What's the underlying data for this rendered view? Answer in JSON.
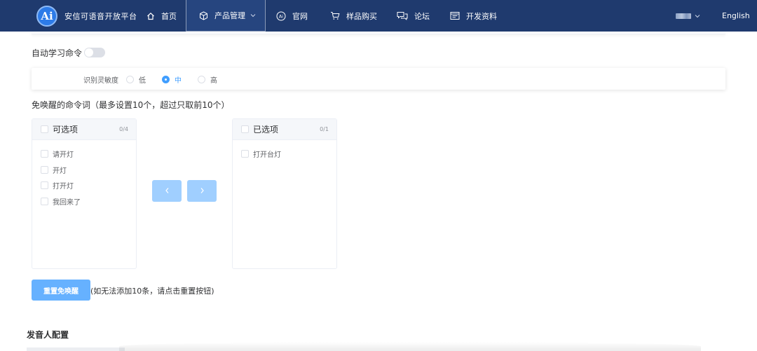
{
  "nav": {
    "logo_text": "安信可语音开放平台",
    "logo_letters": "Ai",
    "items": [
      {
        "label": "首页",
        "icon": "home-icon"
      },
      {
        "label": "产品管理",
        "icon": "cube-icon",
        "active": true
      },
      {
        "label": "官网",
        "icon": "ai-badge-icon"
      },
      {
        "label": "样品购买",
        "icon": "cart-icon"
      },
      {
        "label": "论坛",
        "icon": "chat-icon"
      },
      {
        "label": "开发资料",
        "icon": "document-icon"
      }
    ],
    "language": "English"
  },
  "auto_learn": {
    "label": "自动学习命令",
    "enabled": false
  },
  "sensitivity": {
    "label": "识别灵敏度",
    "options": [
      "低",
      "中",
      "高"
    ],
    "selected": "中"
  },
  "wake_free": {
    "label": "免唤醒的命令词（最多设置10个，超过只取前10个）",
    "available": {
      "title": "可选项",
      "count": "0/4",
      "items": [
        "请开灯",
        "开灯",
        "打开灯",
        "我回来了"
      ]
    },
    "selected": {
      "title": "已选项",
      "count": "0/1",
      "items": [
        "打开台灯"
      ]
    },
    "reset_button": "重置免唤醒",
    "reset_note": "(如无法添加10条，请点击重置按钮)"
  },
  "speaker": {
    "title": "发音人配置"
  },
  "colors": {
    "nav_bg": "#1f3a6e",
    "primary": "#409eff",
    "primary_light": "#a0cfff"
  }
}
